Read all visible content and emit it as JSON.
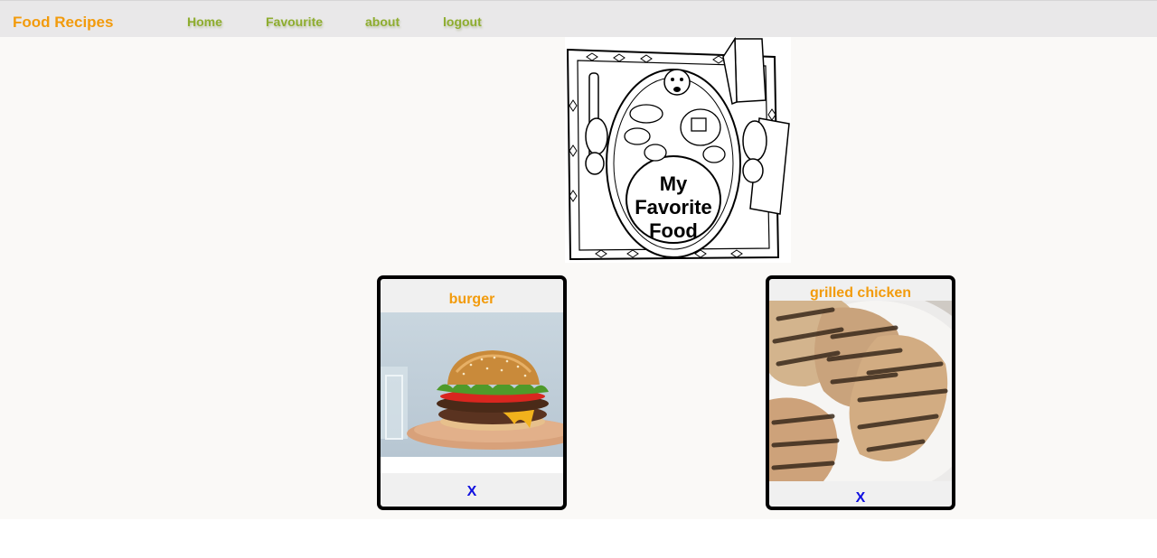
{
  "navbar": {
    "brand": "Food Recipes",
    "links": [
      "Home",
      "Favourite",
      "about",
      "logout"
    ]
  },
  "hero": {
    "text_lines": [
      "My",
      "Favorite",
      "Food"
    ]
  },
  "cards": [
    {
      "title": "burger",
      "remove_label": "X"
    },
    {
      "title": "grilled chicken",
      "remove_label": "X"
    }
  ],
  "colors": {
    "brand": "#f29b0c",
    "nav_link": "#8ead2f",
    "remove": "#1010e0",
    "card_border": "#000000"
  }
}
